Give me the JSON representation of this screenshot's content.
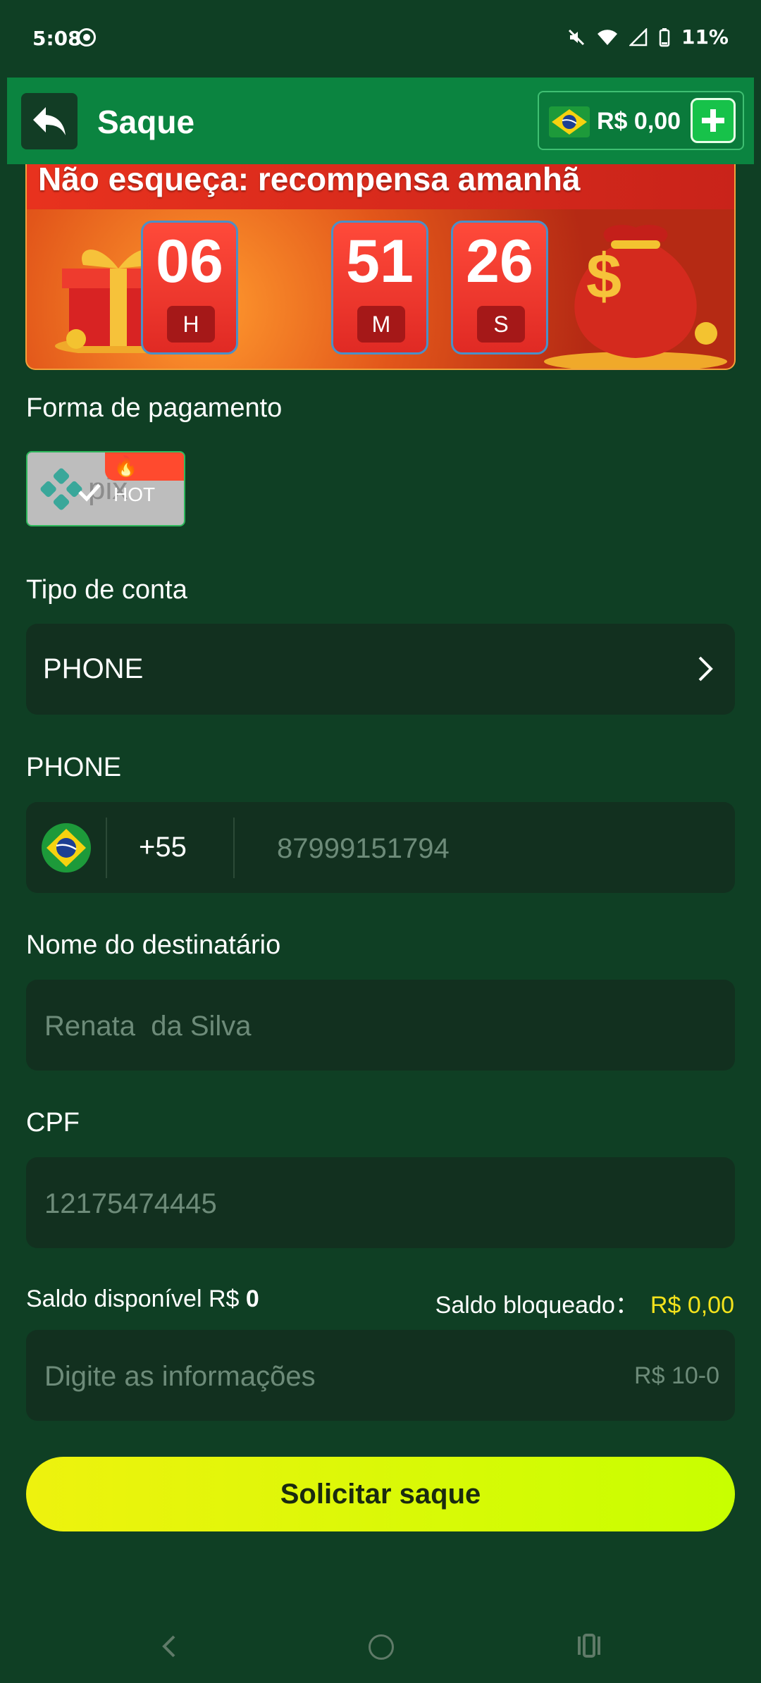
{
  "status": {
    "time": "5:08",
    "battery": "11%"
  },
  "header": {
    "title": "Saque",
    "balance": "R$ 0,00"
  },
  "banner": {
    "title": "Não esqueça: recompensa amanhã",
    "timer": [
      {
        "value": "06",
        "unit": "H"
      },
      {
        "value": "51",
        "unit": "M"
      },
      {
        "value": "26",
        "unit": "S"
      }
    ]
  },
  "payment": {
    "label": "Forma de pagamento",
    "method": "pix",
    "badge": "HOT"
  },
  "account_type": {
    "label": "Tipo de conta",
    "value": "PHONE"
  },
  "phone": {
    "label": "PHONE",
    "country_code": "+55",
    "placeholder": "87999151794"
  },
  "recipient": {
    "label": "Nome do destinatário",
    "placeholder": "Renata  da Silva"
  },
  "cpf": {
    "label": "CPF",
    "placeholder": "12175474445"
  },
  "balances": {
    "available_label": "Saldo disponível R$",
    "available_value": "0",
    "blocked_label": "Saldo bloqueado：",
    "blocked_value": "R$ 0,00"
  },
  "amount": {
    "placeholder": "Digite as informações",
    "range_hint": "R$ 10-0"
  },
  "submit": {
    "label": "Solicitar saque"
  },
  "colors": {
    "background": "#0f3f24",
    "header": "#0b8440",
    "field": "#12301f",
    "accent_yellow": "#f3e21c",
    "button": "#d8f80a"
  }
}
